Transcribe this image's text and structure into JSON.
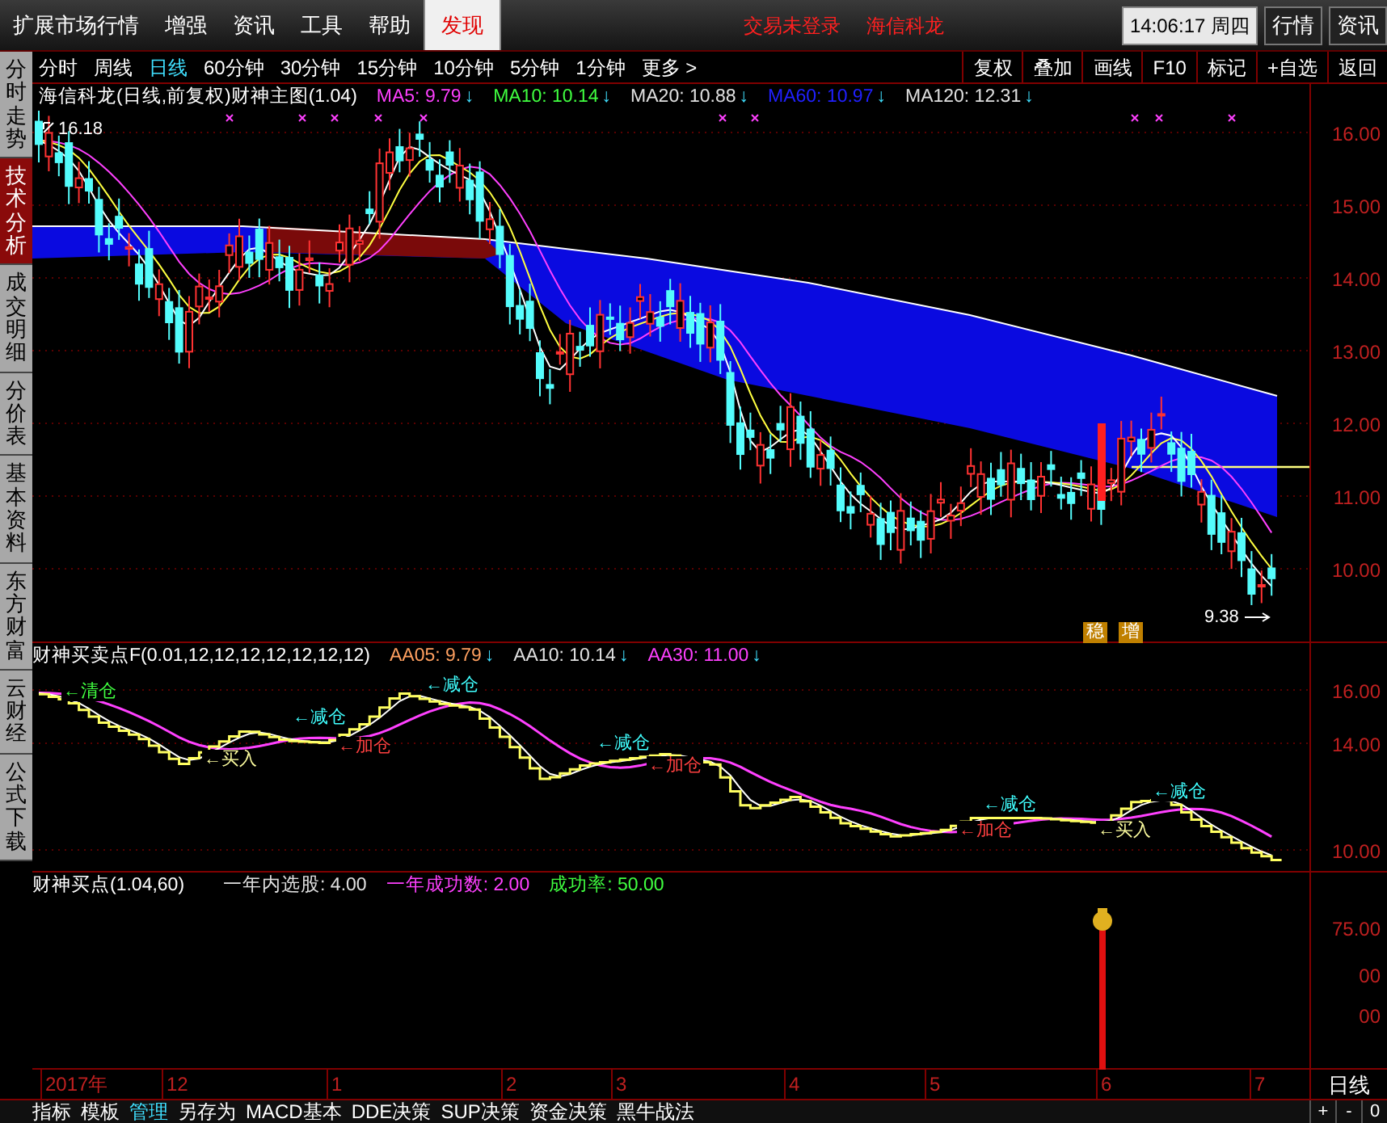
{
  "menu_bar": {
    "items": [
      {
        "label": "扩展市场行情",
        "selected": false
      },
      {
        "label": "增强",
        "selected": false
      },
      {
        "label": "资讯",
        "selected": false
      },
      {
        "label": "工具",
        "selected": false
      },
      {
        "label": "帮助",
        "selected": false
      },
      {
        "label": "发现",
        "selected": true
      }
    ],
    "status": [
      "交易未登录",
      "海信科龙"
    ],
    "clock": "14:06:17 周四",
    "buttons": [
      "行情",
      "资讯"
    ]
  },
  "period_bar": {
    "tabs": [
      {
        "label": "分时",
        "selected": false
      },
      {
        "label": "周线",
        "selected": false
      },
      {
        "label": "日线",
        "selected": true
      },
      {
        "label": "60分钟",
        "selected": false
      },
      {
        "label": "30分钟",
        "selected": false
      },
      {
        "label": "15分钟",
        "selected": false
      },
      {
        "label": "10分钟",
        "selected": false
      },
      {
        "label": "5分钟",
        "selected": false
      },
      {
        "label": "1分钟",
        "selected": false
      },
      {
        "label": "更多 >",
        "selected": false
      }
    ],
    "tools": [
      "复权",
      "叠加",
      "画线",
      "F10",
      "标记",
      "+自选",
      "返回"
    ]
  },
  "side_tabs": [
    {
      "label": "分时走势",
      "selected": false
    },
    {
      "label": "技术分析",
      "selected": true
    },
    {
      "label": "成交明细",
      "selected": false
    },
    {
      "label": "分价表",
      "selected": false
    },
    {
      "label": "基本资料",
      "selected": false
    },
    {
      "label": "东方财富",
      "selected": false
    },
    {
      "label": "云财经",
      "selected": false
    },
    {
      "label": "公式下载",
      "selected": false
    }
  ],
  "main_chart": {
    "title": "海信科龙(日线,前复权)财神主图(1.04)",
    "indicators": [
      {
        "label": "MA5: 9.79",
        "arrow": "↓",
        "color": "#ff40ff"
      },
      {
        "label": "MA10: 10.14",
        "arrow": "↓",
        "color": "#40ff40"
      },
      {
        "label": "MA20: 10.88",
        "arrow": "↓",
        "color": "#e0e0e0"
      },
      {
        "label": "MA60: 10.97",
        "arrow": "↓",
        "color": "#2020ff"
      },
      {
        "label": "MA120: 12.31",
        "arrow": "↓",
        "color": "#e0e0e0"
      }
    ],
    "high_label": "16.18",
    "low_label": "9.38",
    "tags": [
      "稳",
      "增"
    ],
    "axis": [
      "16.00",
      "15.00",
      "14.00",
      "13.00",
      "12.00",
      "11.00",
      "10.00"
    ]
  },
  "signal_panel": {
    "title": "财神买卖点F(0.01,12,12,12,12,12,12,12)",
    "indicators": [
      {
        "label": "AA05: 9.79",
        "arrow": "↓",
        "color": "#ffa060"
      },
      {
        "label": "AA10: 10.14",
        "arrow": "↓",
        "color": "#e0e0e0"
      },
      {
        "label": "AA30: 11.00",
        "arrow": "↓",
        "color": "#ff40ff"
      }
    ],
    "annotations": [
      {
        "label": "←减仓",
        "color": "#40ffff"
      },
      {
        "label": "←清仓",
        "color": "#40ff40"
      },
      {
        "label": "←减仓",
        "color": "#40ffff"
      },
      {
        "label": "←加仓",
        "color": "#ff4040"
      },
      {
        "label": "←减仓",
        "color": "#40ffff"
      },
      {
        "label": "←买入",
        "color": "#ffffa0"
      },
      {
        "label": "←加仓",
        "color": "#ff4040"
      },
      {
        "label": "←减仓",
        "color": "#40ffff"
      },
      {
        "label": "←减仓",
        "color": "#40ffff"
      },
      {
        "label": "←加仓",
        "color": "#ff4040"
      },
      {
        "label": "←买入",
        "color": "#ffffa0"
      }
    ],
    "axis": [
      "16.00",
      "14.00",
      "10.00"
    ]
  },
  "buy_panel": {
    "title": "财神买点(1.04,60)",
    "stats": [
      {
        "label": "一年内选股: 4.00",
        "color": "#e0e0e0"
      },
      {
        "label": "一年成功数: 2.00",
        "color": "#ff40ff"
      },
      {
        "label": "成功率: 50.00",
        "color": "#40ff40"
      }
    ],
    "axis": [
      "75.00",
      "00",
      "00"
    ]
  },
  "date_axis": {
    "labels": [
      "2017年",
      "12",
      "1",
      "2",
      "3",
      "4",
      "5",
      "6",
      "7"
    ],
    "period": "日线"
  },
  "bottom_bar": {
    "tabs": [
      {
        "label": "指标",
        "selected": false
      },
      {
        "label": "模板",
        "selected": false
      },
      {
        "label": "管理",
        "selected": true
      },
      {
        "label": "另存为",
        "selected": false
      },
      {
        "label": "MACD基本",
        "selected": false
      },
      {
        "label": "DDE决策",
        "selected": false
      },
      {
        "label": "SUP决策",
        "selected": false
      },
      {
        "label": "资金决策",
        "selected": false
      },
      {
        "label": "黑牛战法",
        "selected": false
      }
    ],
    "controls": [
      "+",
      "-",
      "0"
    ]
  }
}
